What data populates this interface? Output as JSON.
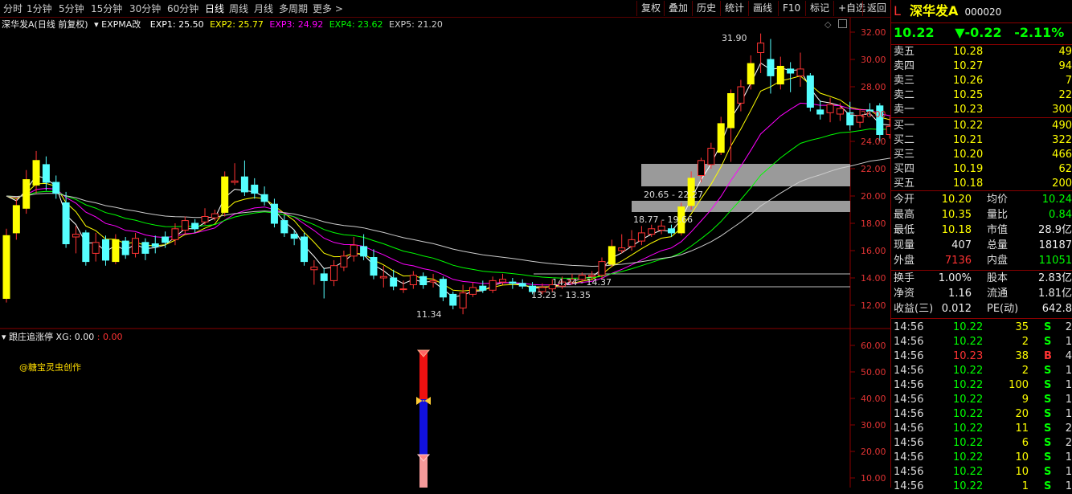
{
  "periods": [
    "分时",
    "1分钟",
    "5分钟",
    "15分钟",
    "30分钟",
    "60分钟",
    "日线",
    "周线",
    "月线",
    "多周期",
    "更多 >"
  ],
  "active_period": "日线",
  "toolbar": [
    "复权",
    "叠加",
    "历史",
    "统计",
    "画线",
    "F10",
    "标记",
    "+自选",
    "返回"
  ],
  "stock": {
    "flag": "L",
    "name": "深华发A",
    "code": "000020",
    "price": "10.22",
    "change": "▼-0.22",
    "pct": "-2.11%"
  },
  "legend": {
    "title": "深华发A(日线 前复权)",
    "indicator": "EXPMA改",
    "exp1": "EXP1: 25.50",
    "exp2": "EXP2: 25.77",
    "exp3": "EXP3: 24.92",
    "exp4": "EXP4: 23.62",
    "exp5": "EXP5: 21.20"
  },
  "colors": {
    "up": "#ff3333",
    "down": "#55ffff",
    "exp1": "#ffffff",
    "exp2": "#ffff00",
    "exp3": "#ff00ff",
    "exp4": "#00ff00",
    "exp5": "#cccccc",
    "bg": "#000000",
    "border": "#8a0000"
  },
  "price_axis": [
    "32.00",
    "30.00",
    "28.00",
    "26.00",
    "24.00",
    "22.00",
    "20.00",
    "18.00",
    "16.00",
    "14.00",
    "12.00"
  ],
  "price_annotations": {
    "high": "31.90",
    "low": "11.34",
    "zone1": "20.65 - 22.27",
    "zone2": "18.77 - 19.66",
    "line1": "14.24 - 14.37",
    "line2": "13.23 - 13.35"
  },
  "indicator": {
    "name": "跟庄追涨停",
    "xg": "XG: 0.00",
    "xg2": ": 0.00",
    "watermark": "@糖宝灵虫创作",
    "axis": [
      "60.00",
      "50.00",
      "40.00",
      "30.00",
      "20.00",
      "10.00"
    ]
  },
  "order_book": {
    "sell": [
      {
        "label": "卖五",
        "price": "10.28",
        "vol": "49"
      },
      {
        "label": "卖四",
        "price": "10.27",
        "vol": "94"
      },
      {
        "label": "卖三",
        "price": "10.26",
        "vol": "7"
      },
      {
        "label": "卖二",
        "price": "10.25",
        "vol": "22"
      },
      {
        "label": "卖一",
        "price": "10.23",
        "vol": "300"
      }
    ],
    "buy": [
      {
        "label": "买一",
        "price": "10.22",
        "vol": "490"
      },
      {
        "label": "买二",
        "price": "10.21",
        "vol": "322"
      },
      {
        "label": "买三",
        "price": "10.20",
        "vol": "466"
      },
      {
        "label": "买四",
        "price": "10.19",
        "vol": "62"
      },
      {
        "label": "买五",
        "price": "10.18",
        "vol": "200"
      }
    ]
  },
  "stats": [
    {
      "l1": "今开",
      "v1": "10.20",
      "l2": "均价",
      "v2": "10.24"
    },
    {
      "l1": "最高",
      "v1": "10.35",
      "l2": "量比",
      "v2": "0.84"
    },
    {
      "l1": "最低",
      "v1": "10.18",
      "l2": "市值",
      "v2": "28.9亿"
    },
    {
      "l1": "现量",
      "v1": "407",
      "l2": "总量",
      "v2": "18187"
    },
    {
      "l1": "外盘",
      "v1": "7136",
      "l2": "内盘",
      "v2": "11051"
    },
    {
      "l1": "换手",
      "v1": "1.00%",
      "l2": "股本",
      "v2": "2.83亿"
    },
    {
      "l1": "净资",
      "v1": "1.16",
      "l2": "流通",
      "v2": "1.81亿"
    },
    {
      "l1": "收益(三)",
      "v1": "0.012",
      "l2": "PE(动)",
      "v2": "642.8"
    }
  ],
  "ticks": [
    {
      "t": "14:56",
      "p": "10.22",
      "v": "35",
      "d": "S",
      "n": "2"
    },
    {
      "t": "14:56",
      "p": "10.22",
      "v": "2",
      "d": "S",
      "n": "1"
    },
    {
      "t": "14:56",
      "p": "10.23",
      "v": "38",
      "d": "B",
      "n": "4"
    },
    {
      "t": "14:56",
      "p": "10.22",
      "v": "2",
      "d": "S",
      "n": "1"
    },
    {
      "t": "14:56",
      "p": "10.22",
      "v": "100",
      "d": "S",
      "n": "1"
    },
    {
      "t": "14:56",
      "p": "10.22",
      "v": "9",
      "d": "S",
      "n": "1"
    },
    {
      "t": "14:56",
      "p": "10.22",
      "v": "20",
      "d": "S",
      "n": "1"
    },
    {
      "t": "14:56",
      "p": "10.22",
      "v": "11",
      "d": "S",
      "n": "2"
    },
    {
      "t": "14:56",
      "p": "10.22",
      "v": "6",
      "d": "S",
      "n": "2"
    },
    {
      "t": "14:56",
      "p": "10.22",
      "v": "10",
      "d": "S",
      "n": "1"
    },
    {
      "t": "14:56",
      "p": "10.22",
      "v": "10",
      "d": "S",
      "n": "1"
    },
    {
      "t": "14:56",
      "p": "10.22",
      "v": "1",
      "d": "S",
      "n": "1"
    }
  ],
  "candles": [
    [
      12.5,
      17.1,
      17.6,
      12.2
    ],
    [
      17.3,
      19.3,
      19.8,
      16.8
    ],
    [
      19.1,
      21.2,
      21.9,
      18.7
    ],
    [
      20.8,
      22.6,
      23.3,
      20.2
    ],
    [
      22.3,
      21.0,
      22.9,
      20.4
    ],
    [
      21.0,
      20.2,
      21.5,
      19.8
    ],
    [
      19.5,
      16.5,
      20.3,
      16.2
    ],
    [
      17.0,
      17.2,
      17.8,
      15.8
    ],
    [
      17.3,
      15.2,
      17.5,
      14.9
    ],
    [
      15.8,
      16.6,
      17.3,
      15.2
    ],
    [
      16.8,
      15.3,
      17.1,
      14.9
    ],
    [
      15.2,
      16.8,
      17.2,
      15.0
    ],
    [
      16.7,
      15.7,
      17.0,
      15.4
    ],
    [
      15.8,
      16.9,
      17.3,
      15.5
    ],
    [
      16.6,
      15.8,
      16.9,
      15.3
    ],
    [
      16.5,
      16.3,
      17.1,
      15.8
    ],
    [
      17.0,
      16.6,
      17.4,
      16.2
    ],
    [
      16.8,
      17.6,
      18.0,
      16.4
    ],
    [
      17.5,
      18.2,
      18.5,
      17.2
    ],
    [
      18.0,
      17.6,
      18.3,
      17.3
    ],
    [
      18.1,
      18.5,
      19.1,
      17.9
    ],
    [
      18.4,
      18.7,
      19.0,
      18.2
    ],
    [
      18.8,
      21.4,
      21.8,
      18.5
    ],
    [
      21.0,
      21.1,
      22.4,
      20.8
    ],
    [
      21.4,
      20.3,
      22.6,
      20.0
    ],
    [
      20.8,
      20.2,
      21.3,
      19.8
    ],
    [
      20.1,
      19.6,
      20.7,
      19.3
    ],
    [
      19.4,
      18.0,
      19.8,
      17.7
    ],
    [
      18.2,
      17.3,
      18.6,
      17.0
    ],
    [
      17.2,
      16.9,
      17.5,
      16.4
    ],
    [
      17.0,
      15.2,
      17.3,
      14.9
    ],
    [
      14.6,
      14.8,
      15.3,
      13.5
    ],
    [
      14.3,
      13.8,
      14.7,
      12.5
    ],
    [
      13.8,
      14.9,
      15.3,
      13.4
    ],
    [
      14.8,
      15.6,
      16.0,
      14.5
    ],
    [
      15.6,
      16.4,
      17.0,
      15.2
    ],
    [
      16.3,
      15.6,
      17.2,
      15.3
    ],
    [
      15.5,
      14.2,
      16.1,
      13.9
    ],
    [
      14.0,
      14.1,
      14.9,
      13.3
    ],
    [
      14.0,
      13.4,
      14.6,
      13.1
    ],
    [
      13.2,
      13.2,
      13.8,
      12.9
    ],
    [
      13.5,
      14.2,
      14.5,
      13.2
    ],
    [
      14.1,
      13.5,
      14.4,
      13.2
    ],
    [
      13.7,
      13.8,
      14.3,
      13.3
    ],
    [
      13.9,
      12.6,
      14.1,
      12.3
    ],
    [
      12.8,
      12.0,
      13.0,
      11.7
    ],
    [
      11.8,
      12.9,
      13.5,
      11.34
    ],
    [
      12.8,
      13.3,
      13.7,
      12.6
    ],
    [
      13.4,
      13.1,
      13.8,
      12.9
    ],
    [
      13.1,
      13.8,
      14.1,
      12.9
    ],
    [
      13.7,
      13.9,
      14.3,
      13.5
    ],
    [
      13.7,
      13.6,
      14.0,
      13.2
    ],
    [
      13.6,
      13.4,
      13.9,
      13.2
    ],
    [
      13.4,
      13.0,
      13.7,
      12.8
    ],
    [
      13.0,
      13.3,
      13.6,
      12.8
    ],
    [
      13.2,
      13.5,
      13.9,
      13.0
    ],
    [
      13.4,
      13.7,
      14.1,
      13.2
    ],
    [
      13.7,
      13.9,
      14.3,
      13.5
    ],
    [
      13.9,
      14.2,
      14.4,
      13.7
    ],
    [
      14.1,
      14.2,
      14.5,
      13.9
    ],
    [
      14.2,
      15.2,
      15.5,
      13.9
    ],
    [
      15.0,
      16.3,
      16.8,
      14.8
    ],
    [
      16.0,
      16.2,
      17.2,
      15.8
    ],
    [
      16.3,
      16.8,
      17.5,
      16.0
    ],
    [
      16.7,
      17.3,
      17.8,
      16.4
    ],
    [
      17.2,
      17.6,
      17.9,
      17.0
    ],
    [
      17.5,
      17.8,
      18.2,
      17.2
    ],
    [
      17.6,
      17.3,
      17.9,
      17.0
    ],
    [
      17.3,
      19.2,
      19.5,
      17.1
    ],
    [
      19.3,
      21.3,
      21.8,
      19.0
    ],
    [
      21.5,
      22.6,
      22.8,
      21.0
    ],
    [
      22.3,
      23.5,
      23.9,
      22.0
    ],
    [
      23.2,
      25.3,
      25.8,
      23.0
    ],
    [
      25.0,
      27.5,
      27.8,
      22.5
    ],
    [
      26.8,
      28.0,
      28.5,
      26.2
    ],
    [
      28.2,
      29.7,
      30.3,
      27.8
    ],
    [
      30.5,
      31.2,
      31.9,
      29.0
    ],
    [
      30.0,
      28.8,
      31.5,
      27.5
    ],
    [
      28.2,
      29.5,
      30.2,
      27.8
    ],
    [
      29.3,
      29.0,
      29.8,
      27.6
    ],
    [
      28.8,
      29.3,
      30.5,
      28.0
    ],
    [
      28.8,
      26.5,
      29.0,
      26.2
    ],
    [
      26.3,
      26.0,
      27.0,
      25.6
    ],
    [
      26.1,
      26.7,
      27.2,
      25.4
    ],
    [
      26.0,
      26.4,
      26.8,
      25.5
    ],
    [
      26.1,
      25.2,
      26.9,
      24.8
    ],
    [
      25.4,
      25.9,
      26.4,
      25.0
    ],
    [
      26.3,
      26.2,
      26.8,
      25.9
    ],
    [
      26.6,
      24.5,
      26.8,
      24.0
    ],
    [
      24.5,
      25.1,
      25.8,
      24.2
    ],
    [
      25.2,
      25.6,
      26.0,
      24.8
    ],
    [
      25.6,
      25.8,
      26.6,
      25.0
    ],
    [
      25.6,
      25.2,
      26.4,
      24.9
    ]
  ]
}
